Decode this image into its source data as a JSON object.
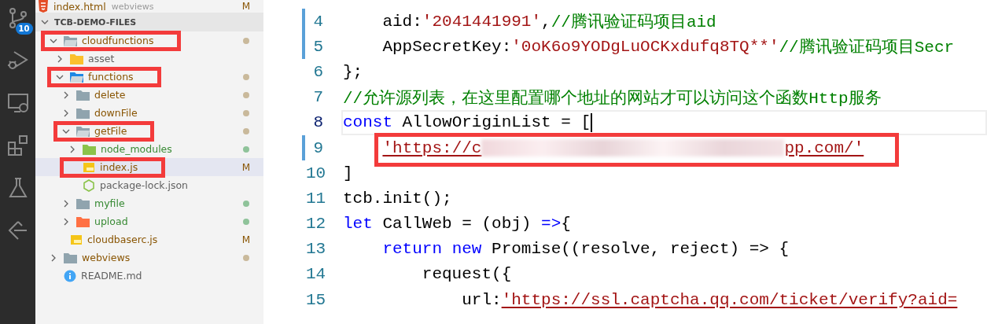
{
  "activity_bar": [
    {
      "kind": "source-control",
      "badge": "10"
    },
    {
      "kind": "debug"
    },
    {
      "kind": "remote"
    },
    {
      "kind": "extensions"
    },
    {
      "kind": "testing"
    },
    {
      "kind": "deploy"
    }
  ],
  "open_editor": {
    "name": "index.html",
    "description": "webviews",
    "badge": "M"
  },
  "explorer": {
    "title": "TCB-DEMO-FILES",
    "expanded": true,
    "items": [
      {
        "name": "cloudfunctions",
        "kind": "folder",
        "expanded": true,
        "modified": true,
        "color": "#c9b99b",
        "highlighted": true,
        "selected": false,
        "children": [
          {
            "name": "asset",
            "kind": "asset-folder",
            "expanded": false,
            "modified": false,
            "untracked": false,
            "highlighted": false,
            "selected": false
          },
          {
            "name": "functions",
            "kind": "functions-folder",
            "expanded": true,
            "modified": true,
            "color": "#c9b99b",
            "highlighted": true,
            "selected": false,
            "children": [
              {
                "name": "delete",
                "kind": "folder",
                "expanded": false,
                "modified": true,
                "color": "#c9b99b",
                "highlighted": false,
                "selected": false
              },
              {
                "name": "downFile",
                "kind": "folder",
                "expanded": false,
                "modified": true,
                "color": "#c9b99b",
                "highlighted": false,
                "selected": false
              },
              {
                "name": "getFile",
                "kind": "folder",
                "expanded": true,
                "modified": true,
                "color": "#c9b99b",
                "highlighted": true,
                "selected": false,
                "children": [
                  {
                    "name": "node_modules",
                    "kind": "node-folder",
                    "expanded": false,
                    "modified": false,
                    "untracked": true,
                    "color": "#8fc39a",
                    "highlighted": false,
                    "selected": false
                  },
                  {
                    "name": "index.js",
                    "kind": "js-file",
                    "modified": true,
                    "badge": "M",
                    "highlighted": true,
                    "selected": true
                  },
                  {
                    "name": "package-lock.json",
                    "kind": "json-file",
                    "modified": false,
                    "untracked": false,
                    "highlighted": false,
                    "selected": false
                  }
                ]
              },
              {
                "name": "myfile",
                "kind": "folder",
                "expanded": false,
                "modified": false,
                "untracked": true,
                "color": "#8fc39a",
                "highlighted": false,
                "selected": false
              },
              {
                "name": "upload",
                "kind": "upload-folder",
                "expanded": false,
                "modified": false,
                "untracked": true,
                "color": "#8fc39a",
                "highlighted": false,
                "selected": false
              }
            ]
          },
          {
            "name": "cloudbaserc.js",
            "kind": "js-file",
            "modified": true,
            "badge": "M",
            "highlighted": false,
            "selected": false
          }
        ]
      },
      {
        "name": "webviews",
        "kind": "folder",
        "expanded": false,
        "modified": true,
        "color": "#c9b99b",
        "highlighted": false,
        "selected": false
      },
      {
        "name": "README.md",
        "kind": "info-file",
        "modified": false,
        "untracked": false,
        "highlighted": false,
        "selected": false
      }
    ]
  },
  "editor": {
    "lines": [
      {
        "number": "4",
        "modified": true,
        "current": false,
        "highlighted": false,
        "tokens": [
          {
            "kind": "plain",
            "text": "    aid:"
          },
          {
            "kind": "string",
            "text": "'2041441991'"
          },
          {
            "kind": "plain",
            "text": ","
          },
          {
            "kind": "comment",
            "text": "//腾讯验证码项目aid"
          }
        ]
      },
      {
        "number": "5",
        "modified": true,
        "current": false,
        "highlighted": false,
        "tokens": [
          {
            "kind": "plain",
            "text": "    AppSecretKey:"
          },
          {
            "kind": "string",
            "text": "'0oK6o9YODgLuOCKxdufq8TQ**'"
          },
          {
            "kind": "comment",
            "text": "//腾讯验证码项目Secr"
          }
        ]
      },
      {
        "number": "6",
        "modified": false,
        "current": false,
        "highlighted": false,
        "tokens": [
          {
            "kind": "plain",
            "text": "};"
          }
        ]
      },
      {
        "number": "7",
        "modified": false,
        "current": false,
        "highlighted": false,
        "tokens": [
          {
            "kind": "comment",
            "text": "//允许源列表，在这里配置哪个地址的网站才可以访问这个函数Http服务"
          }
        ]
      },
      {
        "number": "8",
        "modified": false,
        "current": true,
        "highlighted": false,
        "tokens": [
          {
            "kind": "keyword",
            "text": "const"
          },
          {
            "kind": "plain",
            "text": " AllowOriginList = ["
          }
        ]
      },
      {
        "number": "9",
        "modified": true,
        "current": false,
        "highlighted": true,
        "tokens": [
          {
            "kind": "link",
            "text": "    'https://c"
          },
          {
            "kind": "redacted"
          },
          {
            "kind": "link",
            "text": "pp.com/'"
          }
        ]
      },
      {
        "number": "10",
        "modified": false,
        "current": false,
        "highlighted": false,
        "tokens": [
          {
            "kind": "plain",
            "text": "]"
          }
        ]
      },
      {
        "number": "11",
        "modified": false,
        "current": false,
        "highlighted": false,
        "tokens": [
          {
            "kind": "plain",
            "text": "tcb.init();"
          }
        ]
      },
      {
        "number": "12",
        "modified": false,
        "current": false,
        "highlighted": false,
        "tokens": [
          {
            "kind": "keyword",
            "text": "let"
          },
          {
            "kind": "plain",
            "text": " CallWeb = (obj) "
          },
          {
            "kind": "keyword",
            "text": "=>"
          },
          {
            "kind": "plain",
            "text": "{"
          }
        ]
      },
      {
        "number": "13",
        "modified": false,
        "current": false,
        "highlighted": false,
        "tokens": [
          {
            "kind": "keyword",
            "text": "    return"
          },
          {
            "kind": "keyword",
            "text": " new"
          },
          {
            "kind": "plain",
            "text": " Promise((resolve, reject) => {"
          }
        ]
      },
      {
        "number": "14",
        "modified": false,
        "current": false,
        "highlighted": false,
        "tokens": [
          {
            "kind": "plain",
            "text": "        request({"
          }
        ]
      },
      {
        "number": "15",
        "modified": false,
        "current": false,
        "highlighted": false,
        "tokens": [
          {
            "kind": "plain",
            "text": "            url:"
          },
          {
            "kind": "link",
            "text": "'https://ssl.captcha.qq.com/ticket/verify?aid="
          }
        ]
      }
    ]
  }
}
